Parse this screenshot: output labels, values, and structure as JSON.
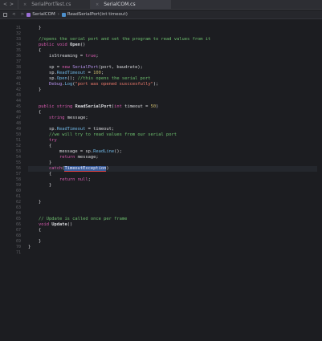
{
  "tabs": {
    "nav_back": "<",
    "nav_forward": ">",
    "items": [
      {
        "label": "SerialPortTest.cs",
        "close": "×"
      },
      {
        "label": "SerialCOM.cs",
        "close": "×"
      }
    ]
  },
  "jumpbar": {
    "file": "SerialCOM",
    "method": "ReadSerialPort(int timeout)"
  },
  "editor": {
    "line_numbers": [
      "31",
      "32",
      "33",
      "34",
      "35",
      "36",
      "37",
      "38",
      "39",
      "40",
      "41",
      "42",
      "43",
      "44",
      "45",
      "46",
      "47",
      "48",
      "49",
      "50",
      "51",
      "52",
      "53",
      "54",
      "55",
      "56",
      "57",
      "58",
      "59",
      "60",
      "61",
      "62",
      "63",
      "64",
      "65",
      "66",
      "67",
      "68",
      "69",
      "70",
      "71"
    ],
    "lines": [
      {
        "parts": [
          {
            "t": "    }"
          }
        ]
      },
      {
        "parts": []
      },
      {
        "parts": [
          {
            "t": "    //opens the serial port and set the program to read values from it",
            "c": "cm"
          }
        ]
      },
      {
        "parts": [
          {
            "t": "    "
          },
          {
            "t": "public",
            "c": "kw"
          },
          {
            "t": " "
          },
          {
            "t": "void",
            "c": "kw"
          },
          {
            "t": " "
          },
          {
            "t": "Open",
            "c": "bold"
          },
          {
            "t": "()"
          }
        ]
      },
      {
        "parts": [
          {
            "t": "    {"
          }
        ]
      },
      {
        "parts": [
          {
            "t": "        isStreaming = "
          },
          {
            "t": "true",
            "c": "kw"
          },
          {
            "t": ";"
          }
        ]
      },
      {
        "parts": []
      },
      {
        "parts": [
          {
            "t": "        sp = "
          },
          {
            "t": "new",
            "c": "kw"
          },
          {
            "t": " "
          },
          {
            "t": "SerialPort",
            "c": "ty"
          },
          {
            "t": "(port, baudrate);"
          }
        ]
      },
      {
        "parts": [
          {
            "t": "        sp."
          },
          {
            "t": "ReadTimeout",
            "c": "mt"
          },
          {
            "t": " = "
          },
          {
            "t": "100",
            "c": "num"
          },
          {
            "t": ";"
          }
        ]
      },
      {
        "parts": [
          {
            "t": "        sp."
          },
          {
            "t": "Open",
            "c": "mt"
          },
          {
            "t": "(); "
          },
          {
            "t": "//this opens the serial port",
            "c": "cm"
          }
        ]
      },
      {
        "parts": [
          {
            "t": "        "
          },
          {
            "t": "Debug",
            "c": "ty"
          },
          {
            "t": "."
          },
          {
            "t": "Log",
            "c": "mt"
          },
          {
            "t": "("
          },
          {
            "t": "\"port was opened susccesfully\"",
            "c": "str"
          },
          {
            "t": ");"
          }
        ]
      },
      {
        "parts": [
          {
            "t": "    }"
          }
        ]
      },
      {
        "parts": []
      },
      {
        "parts": []
      },
      {
        "parts": [
          {
            "t": "    "
          },
          {
            "t": "public",
            "c": "kw"
          },
          {
            "t": " "
          },
          {
            "t": "string",
            "c": "kw"
          },
          {
            "t": " "
          },
          {
            "t": "ReadSerialPort",
            "c": "bold"
          },
          {
            "t": "("
          },
          {
            "t": "int",
            "c": "kw"
          },
          {
            "t": " timeout = "
          },
          {
            "t": "50",
            "c": "num"
          },
          {
            "t": ")"
          }
        ]
      },
      {
        "parts": [
          {
            "t": "    {"
          }
        ]
      },
      {
        "parts": [
          {
            "t": "        "
          },
          {
            "t": "string",
            "c": "kw"
          },
          {
            "t": " message;"
          }
        ]
      },
      {
        "parts": []
      },
      {
        "parts": [
          {
            "t": "        sp."
          },
          {
            "t": "ReadTimeout",
            "c": "mt"
          },
          {
            "t": " = timeout;"
          }
        ]
      },
      {
        "parts": [
          {
            "t": "        "
          },
          {
            "t": "//we will try to read values from our serial port",
            "c": "cm"
          }
        ]
      },
      {
        "parts": [
          {
            "t": "        "
          },
          {
            "t": "try",
            "c": "kw"
          }
        ]
      },
      {
        "parts": [
          {
            "t": "        {"
          }
        ]
      },
      {
        "parts": [
          {
            "t": "            message = sp."
          },
          {
            "t": "ReadLine",
            "c": "mt"
          },
          {
            "t": "();"
          }
        ]
      },
      {
        "parts": [
          {
            "t": "            "
          },
          {
            "t": "return",
            "c": "kw"
          },
          {
            "t": " message;"
          }
        ]
      },
      {
        "parts": [
          {
            "t": "        }"
          }
        ]
      },
      {
        "parts": [
          {
            "t": "        "
          },
          {
            "t": "catch",
            "c": "kw"
          },
          {
            "t": "("
          },
          {
            "t": "TimeoutException",
            "c": "hl"
          },
          {
            "t": ")"
          }
        ],
        "current": true
      },
      {
        "parts": [
          {
            "t": "        {"
          }
        ]
      },
      {
        "parts": [
          {
            "t": "            "
          },
          {
            "t": "return",
            "c": "kw"
          },
          {
            "t": " "
          },
          {
            "t": "null",
            "c": "kw"
          },
          {
            "t": ";"
          }
        ]
      },
      {
        "parts": [
          {
            "t": "        }"
          }
        ]
      },
      {
        "parts": []
      },
      {
        "parts": []
      },
      {
        "parts": [
          {
            "t": "    }"
          }
        ]
      },
      {
        "parts": []
      },
      {
        "parts": []
      },
      {
        "parts": [
          {
            "t": "    "
          },
          {
            "t": "// Update is called once per frame",
            "c": "cm"
          }
        ]
      },
      {
        "parts": [
          {
            "t": "    "
          },
          {
            "t": "void",
            "c": "kw"
          },
          {
            "t": " "
          },
          {
            "t": "Update",
            "c": "bold"
          },
          {
            "t": "()"
          }
        ]
      },
      {
        "parts": [
          {
            "t": "    {"
          }
        ]
      },
      {
        "parts": []
      },
      {
        "parts": [
          {
            "t": "    }"
          }
        ]
      },
      {
        "parts": [
          {
            "t": "}"
          }
        ]
      },
      {
        "parts": []
      }
    ]
  },
  "colors": {
    "background": "#1c1d21",
    "keyword": "#d95bb0",
    "comment": "#6ec06f",
    "type": "#b38fe8",
    "method": "#6fb7e5",
    "string": "#ee7a6c",
    "number": "#c9b86b"
  }
}
